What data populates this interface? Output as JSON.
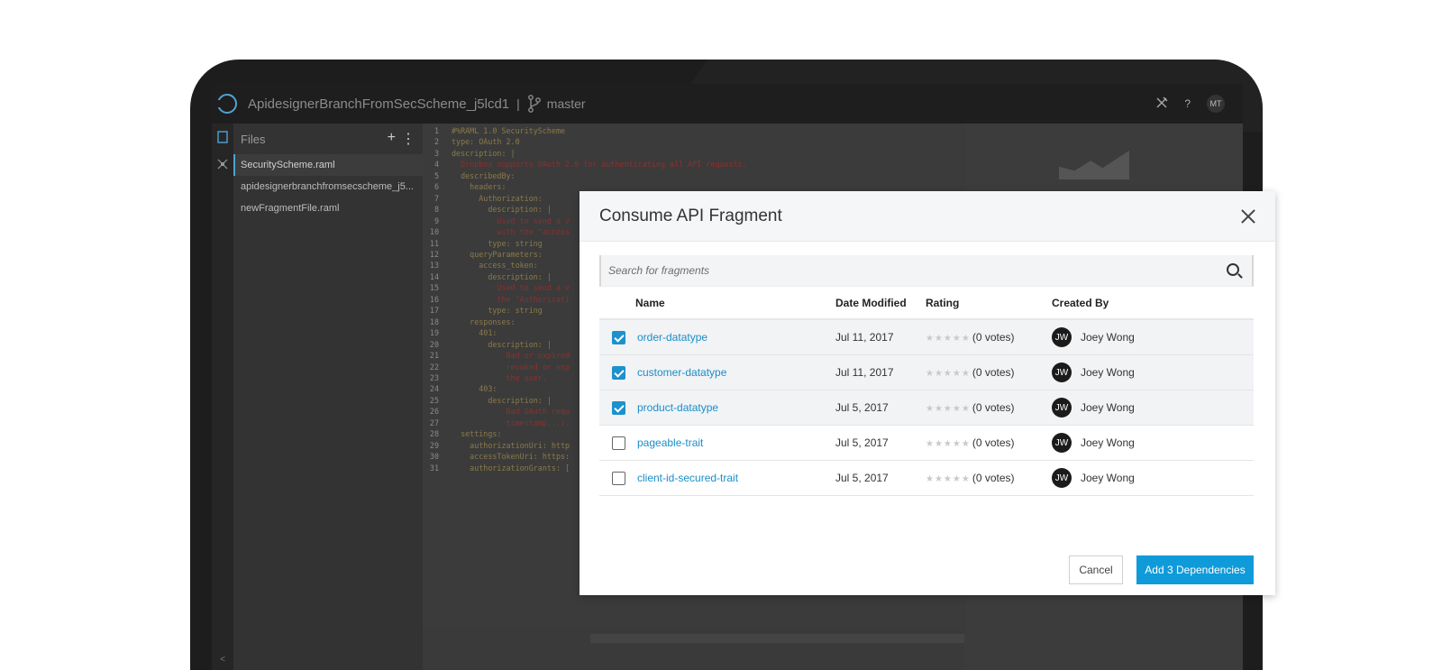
{
  "app": {
    "project_name": "ApidesignerBranchFromSecScheme_j5lcd1",
    "separator": "|",
    "branch": "master",
    "help_label": "?",
    "user_initials": "MT"
  },
  "files": {
    "title": "Files",
    "add_label": "+",
    "more_label": "⋮",
    "items": [
      {
        "label": "SecurityScheme.raml"
      },
      {
        "label": "apidesignerbranchfromsecscheme_j5..."
      },
      {
        "label": "newFragmentFile.raml"
      }
    ],
    "collapse_label": "<"
  },
  "editor": {
    "lines": [
      {
        "n": "1",
        "t": "#%RAML 1.0 SecurityScheme"
      },
      {
        "n": "2",
        "t": "type: OAuth 2.0"
      },
      {
        "n": "3",
        "t": "description: |"
      },
      {
        "n": "4",
        "t": "  Dropbox supports OAuth 2.0 for authenticating all API requests."
      },
      {
        "n": "5",
        "t": "  describedBy:"
      },
      {
        "n": "6",
        "t": "    headers:"
      },
      {
        "n": "7",
        "t": "      Authorization:"
      },
      {
        "n": "8",
        "t": "        description: |"
      },
      {
        "n": "9",
        "t": "          Used to send a v"
      },
      {
        "n": "10",
        "t": "          with the \"access"
      },
      {
        "n": "11",
        "t": "        type: string"
      },
      {
        "n": "12",
        "t": "    queryParameters:"
      },
      {
        "n": "13",
        "t": "      access_token:"
      },
      {
        "n": "14",
        "t": "        description: |"
      },
      {
        "n": "15",
        "t": "          Used to send a v"
      },
      {
        "n": "16",
        "t": "          the \"Authorizati"
      },
      {
        "n": "17",
        "t": "        type: string"
      },
      {
        "n": "18",
        "t": "    responses:"
      },
      {
        "n": "19",
        "t": "      401:"
      },
      {
        "n": "20",
        "t": "        description: |"
      },
      {
        "n": "21",
        "t": "            Bad or expired"
      },
      {
        "n": "22",
        "t": "            revoked or exp"
      },
      {
        "n": "23",
        "t": "            the user."
      },
      {
        "n": "24",
        "t": "      403:"
      },
      {
        "n": "25",
        "t": "        description: |"
      },
      {
        "n": "26",
        "t": "            Bad OAuth requ"
      },
      {
        "n": "27",
        "t": "            timestamp...)."
      },
      {
        "n": "28",
        "t": "  settings:"
      },
      {
        "n": "29",
        "t": "    authorizationUri: http"
      },
      {
        "n": "30",
        "t": "    accessTokenUri: https:"
      },
      {
        "n": "31",
        "t": "    authorizationGrants: ["
      }
    ]
  },
  "modal": {
    "title": "Consume API Fragment",
    "search_placeholder": "Search for fragments",
    "columns": {
      "name": "Name",
      "date": "Date Modified",
      "rating": "Rating",
      "created_by": "Created By"
    },
    "rows": [
      {
        "checked": true,
        "name": "order-datatype",
        "date": "Jul 11, 2017",
        "stars": "★★★★★",
        "votes": "(0 votes)",
        "initials": "JW",
        "author": "Joey Wong"
      },
      {
        "checked": true,
        "name": "customer-datatype",
        "date": "Jul 11, 2017",
        "stars": "★★★★★",
        "votes": "(0 votes)",
        "initials": "JW",
        "author": "Joey Wong"
      },
      {
        "checked": true,
        "name": "product-datatype",
        "date": "Jul 5, 2017",
        "stars": "★★★★★",
        "votes": "(0 votes)",
        "initials": "JW",
        "author": "Joey Wong"
      },
      {
        "checked": false,
        "name": "pageable-trait",
        "date": "Jul 5, 2017",
        "stars": "★★★★★",
        "votes": "(0 votes)",
        "initials": "JW",
        "author": "Joey Wong"
      },
      {
        "checked": false,
        "name": "client-id-secured-trait",
        "date": "Jul 5, 2017",
        "stars": "★★★★★",
        "votes": "(0 votes)",
        "initials": "JW",
        "author": "Joey Wong"
      }
    ],
    "cancel_label": "Cancel",
    "add_label": "Add 3 Dependencies"
  },
  "colors": {
    "accent": "#0f9bd9",
    "link": "#1a8ec9",
    "checkbox": "#1d91cb"
  }
}
